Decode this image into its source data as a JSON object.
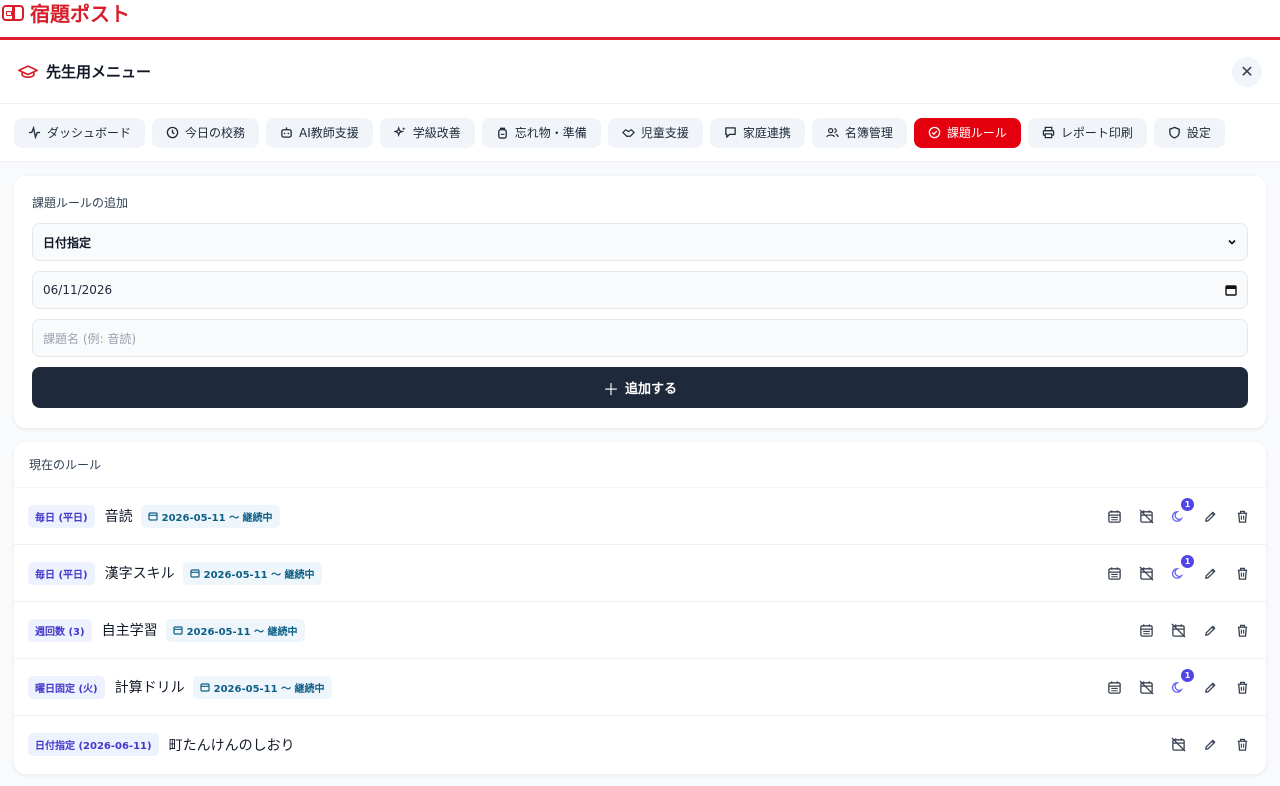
{
  "app": {
    "title": "宿題ポスト",
    "brand_color": "#d81e2a"
  },
  "menu": {
    "title": "先生用メニュー",
    "close_label": "✕"
  },
  "tabs": [
    {
      "label": "ダッシュボード",
      "icon": "activity-icon"
    },
    {
      "label": "今日の校務",
      "icon": "clock-icon"
    },
    {
      "label": "AI教師支援",
      "icon": "robot-icon"
    },
    {
      "label": "学級改善",
      "icon": "sparkles-icon"
    },
    {
      "label": "忘れ物・準備",
      "icon": "backpack-icon"
    },
    {
      "label": "児童支援",
      "icon": "handshake-icon"
    },
    {
      "label": "家庭連携",
      "icon": "message-icon"
    },
    {
      "label": "名簿管理",
      "icon": "users-icon"
    },
    {
      "label": "課題ルール",
      "icon": "check-circle-icon",
      "active": true
    },
    {
      "label": "レポート印刷",
      "icon": "printer-icon"
    },
    {
      "label": "設定",
      "icon": "shield-icon"
    }
  ],
  "add_form": {
    "title": "課題ルールの追加",
    "type_select": "日付指定",
    "date_value": "06/11/2026",
    "name_placeholder": "課題名 (例: 音読)",
    "submit_label": "追加する"
  },
  "rules_section": {
    "title": "現在のルール",
    "rules": [
      {
        "type": "毎日 (平日)",
        "name": "音読",
        "period": "2026-05-11 ～ 継続中",
        "actions": [
          "calendar",
          "calendar-off",
          "moon",
          "edit",
          "delete"
        ],
        "badge_count": "1"
      },
      {
        "type": "毎日 (平日)",
        "name": "漢字スキル",
        "period": "2026-05-11 ～ 継続中",
        "actions": [
          "calendar",
          "calendar-off",
          "moon",
          "edit",
          "delete"
        ],
        "badge_count": "1"
      },
      {
        "type": "週回数 (3)",
        "name": "自主学習",
        "period": "2026-05-11 ～ 継続中",
        "actions": [
          "calendar",
          "calendar-off",
          "edit",
          "delete"
        ]
      },
      {
        "type": "曜日固定 (火)",
        "name": "計算ドリル",
        "period": "2026-05-11 ～ 継続中",
        "actions": [
          "calendar",
          "calendar-off",
          "moon",
          "edit",
          "delete"
        ],
        "badge_count": "1"
      },
      {
        "type": "日付指定 (2026-06-11)",
        "name": "町たんけんのしおり",
        "actions": [
          "calendar-off",
          "edit",
          "delete"
        ]
      }
    ]
  },
  "colors": {
    "active_tab": "#e5000f",
    "primary_button": "#1e293b",
    "badge_count": "#4f46e5"
  }
}
